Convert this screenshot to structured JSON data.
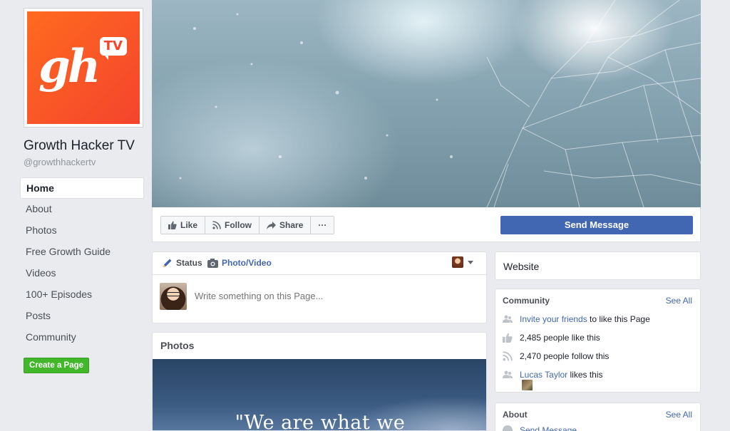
{
  "page": {
    "logo": {
      "main_text": "gh",
      "badge_text": "TV"
    },
    "name": "Growth Hacker TV",
    "handle": "@growthhackertv"
  },
  "nav": {
    "items": [
      {
        "label": "Home",
        "active": true
      },
      {
        "label": "About"
      },
      {
        "label": "Photos"
      },
      {
        "label": "Free Growth Guide"
      },
      {
        "label": "Videos"
      },
      {
        "label": "100+ Episodes"
      },
      {
        "label": "Posts"
      },
      {
        "label": "Community"
      }
    ],
    "create_page": "Create a Page"
  },
  "actions": {
    "like": "Like",
    "follow": "Follow",
    "share": "Share",
    "more": "···",
    "send_message": "Send Message"
  },
  "composer": {
    "tab_status": "Status",
    "tab_photo": "Photo/Video",
    "placeholder": "Write something on this Page..."
  },
  "photos": {
    "title": "Photos",
    "quote": "\"We are what we"
  },
  "sidebar": {
    "website": "Website",
    "community": {
      "title": "Community",
      "see_all": "See All",
      "invite_link": "Invite your friends",
      "invite_rest": " to like this Page",
      "likes": "2,485 people like this",
      "follows": "2,470 people follow this",
      "friend_name": "Lucas Taylor",
      "friend_rest": " likes this"
    },
    "about": {
      "title": "About",
      "see_all": "See All",
      "send_message": "Send Message"
    }
  },
  "colors": {
    "brand_blue": "#4267b2",
    "green": "#42b72a",
    "logo_orange": "#f4442e",
    "background": "#e9ebee"
  }
}
